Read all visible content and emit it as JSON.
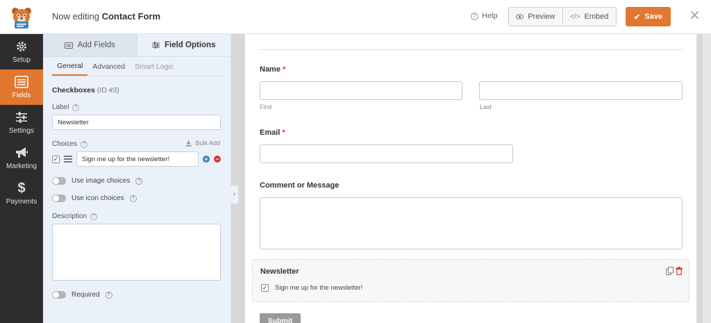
{
  "header": {
    "title_prefix": "Now editing",
    "form_name": "Contact Form",
    "help_label": "Help",
    "preview_label": "Preview",
    "embed_label": "Embed",
    "save_label": "Save",
    "accent_color": "#e27730"
  },
  "leftnav": {
    "items": [
      {
        "label": "Setup",
        "icon": "gear-icon"
      },
      {
        "label": "Fields",
        "icon": "fields-list-icon",
        "active": true
      },
      {
        "label": "Settings",
        "icon": "sliders-icon"
      },
      {
        "label": "Marketing",
        "icon": "megaphone-icon"
      },
      {
        "label": "Payments",
        "icon": "dollar-icon"
      }
    ]
  },
  "panel": {
    "tabs": [
      "Add Fields",
      "Field Options"
    ],
    "subtabs": [
      "General",
      "Advanced",
      "Smart Logic"
    ],
    "field_name": "Checkboxes",
    "field_id": "(ID #3)",
    "label_label": "Label",
    "label_value": "Newsletter",
    "choices_label": "Choices",
    "bulk_add": "Bulk Add",
    "choices": [
      {
        "label": "Sign me up for the newsletter!",
        "checked": true
      }
    ],
    "image_choices": "Use image choices",
    "icon_choices": "Use icon choices",
    "description_label": "Description",
    "required_label": "Required"
  },
  "preview": {
    "name_label": "Name",
    "first_sub": "First",
    "last_sub": "Last",
    "email_label": "Email",
    "comment_label": "Comment or Message",
    "newsletter_label": "Newsletter",
    "newsletter_choice": "Sign me up for the newsletter!",
    "submit_label": "Submit"
  }
}
